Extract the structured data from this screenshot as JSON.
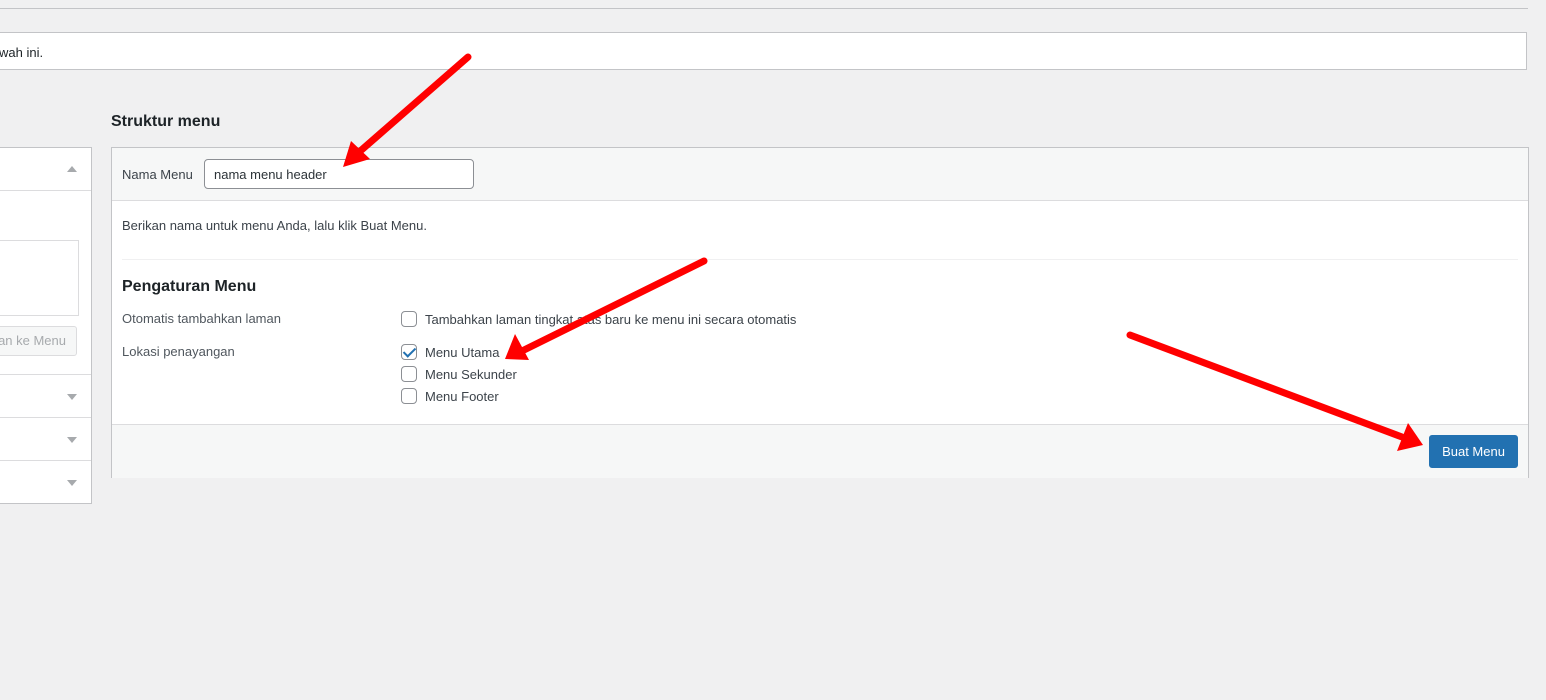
{
  "notice": {
    "text": "wah ini."
  },
  "left_panel": {
    "add_button_label": "an ke Menu"
  },
  "structure": {
    "title": "Struktur menu",
    "name_label": "Nama Menu",
    "name_value": "nama menu header",
    "description": "Berikan nama untuk menu Anda, lalu klik Buat Menu.",
    "settings": {
      "heading": "Pengaturan Menu",
      "auto_add_label": "Otomatis tambahkan laman",
      "auto_add_option": "Tambahkan laman tingkat atas baru ke menu ini secara otomatis",
      "auto_add_checked": false,
      "location_label": "Lokasi penayangan",
      "locations": [
        {
          "label": "Menu Utama",
          "checked": true
        },
        {
          "label": "Menu Sekunder",
          "checked": false
        },
        {
          "label": "Menu Footer",
          "checked": false
        }
      ]
    },
    "create_button": "Buat Menu"
  },
  "colors": {
    "primary": "#2271b1",
    "annotation_arrow": "#ff0000"
  }
}
